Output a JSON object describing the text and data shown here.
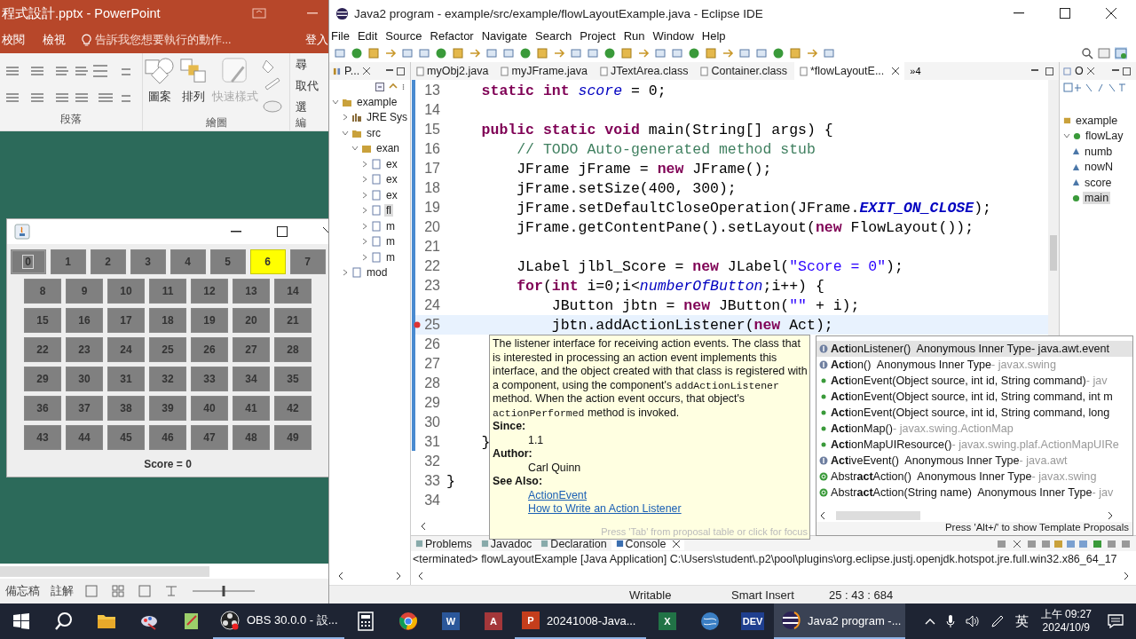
{
  "powerpoint": {
    "title": "程式設計.pptx - PowerPoint",
    "tabs": [
      "校閱",
      "檢視"
    ],
    "tell_me": "告訴我您想要執行的動作...",
    "sign_in": "登入",
    "paragraph_group": {
      "label": "段落"
    },
    "drawing_group": {
      "label": "繪圖",
      "buttons": [
        {
          "label": "圖案",
          "disabled": false
        },
        {
          "label": "排列",
          "disabled": false
        },
        {
          "label": "快速樣式",
          "disabled": true
        }
      ]
    },
    "editing_group": {
      "label": "編",
      "buttons": [
        "尋",
        "取代",
        "選"
      ]
    },
    "status_bar": {
      "notes": "備忘稿",
      "comments": "註解",
      "zoom": {
        "level": 0.5
      }
    }
  },
  "java_frame": {
    "rows": [
      {
        "buttons": [
          {
            "label": "0",
            "highlighted": false,
            "focused": true
          },
          {
            "label": "1",
            "highlighted": false,
            "focused": false
          },
          {
            "label": "2",
            "highlighted": false,
            "focused": false
          },
          {
            "label": "3",
            "highlighted": false,
            "focused": false
          },
          {
            "label": "4",
            "highlighted": false,
            "focused": false
          },
          {
            "label": "5",
            "highlighted": false,
            "focused": false
          },
          {
            "label": "6",
            "highlighted": true,
            "focused": false
          },
          {
            "label": "7",
            "highlighted": false,
            "focused": false
          }
        ]
      },
      {
        "buttons": [
          {
            "label": "8",
            "highlighted": false,
            "focused": false
          },
          {
            "label": "9",
            "highlighted": false,
            "focused": false
          },
          {
            "label": "10",
            "highlighted": false,
            "focused": false
          },
          {
            "label": "11",
            "highlighted": false,
            "focused": false
          },
          {
            "label": "12",
            "highlighted": false,
            "focused": false
          },
          {
            "label": "13",
            "highlighted": false,
            "focused": false
          },
          {
            "label": "14",
            "highlighted": false,
            "focused": false
          }
        ]
      },
      {
        "buttons": [
          {
            "label": "15",
            "highlighted": false,
            "focused": false
          },
          {
            "label": "16",
            "highlighted": false,
            "focused": false
          },
          {
            "label": "17",
            "highlighted": false,
            "focused": false
          },
          {
            "label": "18",
            "highlighted": false,
            "focused": false
          },
          {
            "label": "19",
            "highlighted": false,
            "focused": false
          },
          {
            "label": "20",
            "highlighted": false,
            "focused": false
          },
          {
            "label": "21",
            "highlighted": false,
            "focused": false
          }
        ]
      },
      {
        "buttons": [
          {
            "label": "22",
            "highlighted": false,
            "focused": false
          },
          {
            "label": "23",
            "highlighted": false,
            "focused": false
          },
          {
            "label": "24",
            "highlighted": false,
            "focused": false
          },
          {
            "label": "25",
            "highlighted": false,
            "focused": false
          },
          {
            "label": "26",
            "highlighted": false,
            "focused": false
          },
          {
            "label": "27",
            "highlighted": false,
            "focused": false
          },
          {
            "label": "28",
            "highlighted": false,
            "focused": false
          }
        ]
      },
      {
        "buttons": [
          {
            "label": "29",
            "highlighted": false,
            "focused": false
          },
          {
            "label": "30",
            "highlighted": false,
            "focused": false
          },
          {
            "label": "31",
            "highlighted": false,
            "focused": false
          },
          {
            "label": "32",
            "highlighted": false,
            "focused": false
          },
          {
            "label": "33",
            "highlighted": false,
            "focused": false
          },
          {
            "label": "34",
            "highlighted": false,
            "focused": false
          },
          {
            "label": "35",
            "highlighted": false,
            "focused": false
          }
        ]
      },
      {
        "buttons": [
          {
            "label": "36",
            "highlighted": false,
            "focused": false
          },
          {
            "label": "37",
            "highlighted": false,
            "focused": false
          },
          {
            "label": "38",
            "highlighted": false,
            "focused": false
          },
          {
            "label": "39",
            "highlighted": false,
            "focused": false
          },
          {
            "label": "40",
            "highlighted": false,
            "focused": false
          },
          {
            "label": "41",
            "highlighted": false,
            "focused": false
          },
          {
            "label": "42",
            "highlighted": false,
            "focused": false
          }
        ]
      },
      {
        "buttons": [
          {
            "label": "43",
            "highlighted": false,
            "focused": false
          },
          {
            "label": "44",
            "highlighted": false,
            "focused": false
          },
          {
            "label": "45",
            "highlighted": false,
            "focused": false
          },
          {
            "label": "46",
            "highlighted": false,
            "focused": false
          },
          {
            "label": "47",
            "highlighted": false,
            "focused": false
          },
          {
            "label": "48",
            "highlighted": false,
            "focused": false
          },
          {
            "label": "49",
            "highlighted": false,
            "focused": false
          }
        ]
      }
    ],
    "score_label": "Score = 0"
  },
  "eclipse": {
    "title": "Java2 program - example/src/example/flowLayoutExample.java - Eclipse IDE",
    "menu": [
      "File",
      "Edit",
      "Source",
      "Refactor",
      "Navigate",
      "Search",
      "Project",
      "Run",
      "Window",
      "Help"
    ],
    "explorer": {
      "tab": "P...",
      "tree": [
        {
          "label": "example",
          "kind": "project",
          "expanded": true,
          "selected": false,
          "children": [
            {
              "label": "JRE Sys",
              "kind": "library",
              "expanded": false,
              "selected": false
            },
            {
              "label": "src",
              "kind": "folder",
              "expanded": true,
              "selected": false,
              "children": [
                {
                  "label": "exan",
                  "kind": "package",
                  "expanded": true,
                  "selected": false,
                  "children": [
                    {
                      "label": "ex",
                      "kind": "file",
                      "expanded": false,
                      "selected": false
                    },
                    {
                      "label": "ex",
                      "kind": "file",
                      "expanded": false,
                      "selected": false
                    },
                    {
                      "label": "ex",
                      "kind": "file",
                      "expanded": false,
                      "selected": false
                    },
                    {
                      "label": "fl",
                      "kind": "file",
                      "expanded": false,
                      "selected": true
                    },
                    {
                      "label": "m",
                      "kind": "file",
                      "expanded": false,
                      "selected": false
                    },
                    {
                      "label": "m",
                      "kind": "file",
                      "expanded": false,
                      "selected": false
                    },
                    {
                      "label": "m",
                      "kind": "file",
                      "expanded": false,
                      "selected": false
                    }
                  ]
                }
              ]
            },
            {
              "label": "mod",
              "kind": "file",
              "expanded": false,
              "selected": false
            }
          ]
        }
      ]
    },
    "editor_tabs": [
      {
        "label": "myObj2.java",
        "selected": false
      },
      {
        "label": "myJFrame.java",
        "selected": false
      },
      {
        "label": "JTextArea.class",
        "selected": false
      },
      {
        "label": "Container.class",
        "selected": false
      },
      {
        "label": "*flowLayoutE...",
        "selected": true
      }
    ],
    "more_tabs": "»4",
    "code": [
      {
        "number": "13",
        "current": false,
        "error": false,
        "segments": [
          {
            "text": "    static int ",
            "kind": "kw"
          },
          {
            "text": "score",
            "kind": "field"
          },
          {
            "text": " = 0;",
            "kind": "plain"
          }
        ]
      },
      {
        "number": "14",
        "current": false,
        "error": false
      },
      {
        "number": "15",
        "current": false,
        "error": false,
        "segments": [
          {
            "text": "    public static void",
            "kind": "kw"
          },
          {
            "text": " main(String[] args) {",
            "kind": "plain"
          }
        ]
      },
      {
        "number": "16",
        "current": false,
        "error": false,
        "segments": [
          {
            "text": "        // TODO Auto-generated method stub",
            "kind": "comment"
          }
        ]
      },
      {
        "number": "17",
        "current": false,
        "error": false,
        "segments": [
          {
            "text": "        JFrame jFrame = ",
            "kind": "plain"
          },
          {
            "text": "new",
            "kind": "kw"
          },
          {
            "text": " JFrame();",
            "kind": "plain"
          }
        ]
      },
      {
        "number": "18",
        "current": false,
        "error": false,
        "segments": [
          {
            "text": "        jFrame.setSize(400, 300);",
            "kind": "plain"
          }
        ]
      },
      {
        "number": "19",
        "current": false,
        "error": false,
        "segments": [
          {
            "text": "        jFrame.setDefaultCloseOperation(JFrame.",
            "kind": "plain"
          },
          {
            "text": "EXIT_ON_CLOSE",
            "kind": "const"
          },
          {
            "text": ");",
            "kind": "plain"
          }
        ]
      },
      {
        "number": "20",
        "current": false,
        "error": false,
        "segments": [
          {
            "text": "        jFrame.getContentPane().setLayout(",
            "kind": "plain"
          },
          {
            "text": "new",
            "kind": "kw"
          },
          {
            "text": " FlowLayout());",
            "kind": "plain"
          }
        ]
      },
      {
        "number": "21",
        "current": false,
        "error": false
      },
      {
        "number": "22",
        "current": false,
        "error": false,
        "segments": [
          {
            "text": "        JLabel jlbl_Score = ",
            "kind": "plain"
          },
          {
            "text": "new",
            "kind": "kw"
          },
          {
            "text": " JLabel(",
            "kind": "plain"
          },
          {
            "text": "\"Score = 0\"",
            "kind": "str"
          },
          {
            "text": ");",
            "kind": "plain"
          }
        ]
      },
      {
        "number": "23",
        "current": false,
        "error": false,
        "segments": [
          {
            "text": "        for",
            "kind": "kw"
          },
          {
            "text": "(",
            "kind": "plain"
          },
          {
            "text": "int",
            "kind": "kw"
          },
          {
            "text": " i=0;i<",
            "kind": "plain"
          },
          {
            "text": "numberOfButton",
            "kind": "field"
          },
          {
            "text": ";i++) {",
            "kind": "plain"
          }
        ]
      },
      {
        "number": "24",
        "current": false,
        "error": false,
        "segments": [
          {
            "text": "            JButton jbtn = ",
            "kind": "plain"
          },
          {
            "text": "new",
            "kind": "kw"
          },
          {
            "text": " JButton(",
            "kind": "plain"
          },
          {
            "text": "\"\"",
            "kind": "str"
          },
          {
            "text": " + i);",
            "kind": "plain"
          }
        ]
      },
      {
        "number": "25",
        "current": true,
        "error": true,
        "segments": [
          {
            "text": "            jbtn.addActionListener(",
            "kind": "plain"
          },
          {
            "text": "new",
            "kind": "kw"
          },
          {
            "text": " Act);",
            "kind": "plain"
          }
        ]
      },
      {
        "number": "26",
        "current": false,
        "error": false
      },
      {
        "number": "27",
        "current": false,
        "error": false
      },
      {
        "number": "28",
        "current": false,
        "error": false
      },
      {
        "number": "29",
        "current": false,
        "error": false
      },
      {
        "number": "30",
        "current": false,
        "error": false
      },
      {
        "number": "31",
        "current": false,
        "error": false,
        "segments": [
          {
            "text": "    }",
            "kind": "plain"
          }
        ]
      },
      {
        "number": "32",
        "current": false,
        "error": false
      },
      {
        "number": "33",
        "current": false,
        "error": false,
        "segments": [
          {
            "text": "}",
            "kind": "plain"
          }
        ]
      },
      {
        "number": "34",
        "current": false,
        "error": false
      }
    ],
    "javadoc": {
      "description": [
        {
          "text": "The listener interface for receiving action events. The class that is interested in processing an action event implements this interface, and the object created with that class is registered with a component, using the component's ",
          "kind": "text"
        },
        {
          "text": "addActionListener",
          "kind": "code"
        },
        {
          "text": " method. When the action event occurs, that object's ",
          "kind": "text"
        },
        {
          "text": "actionPerformed",
          "kind": "code"
        },
        {
          "text": " method is invoked.",
          "kind": "text"
        }
      ],
      "since_label": "Since:",
      "since": "1.1",
      "author_label": "Author:",
      "author": "Carl Quinn",
      "see_also_label": "See Also:",
      "links": [
        "ActionEvent",
        "How to Write an Action Listener"
      ],
      "footer": "Press 'Tab' from proposal table or click for focus"
    },
    "proposals": {
      "items": [
        {
          "kind": "interface",
          "signature": "**Act**ionListener()",
          "detail": "Anonymous Inner Type",
          "qualifier": "- java.awt.event",
          "selected": true
        },
        {
          "kind": "interface",
          "signature": "**Act**ion()",
          "detail": "Anonymous Inner Type",
          "qualifier": "- javax.swing",
          "selected": false
        },
        {
          "kind": "constructor",
          "signature": "**Act**ionEvent(Object source, int id, String command)",
          "qualifier": "- jav",
          "selected": false
        },
        {
          "kind": "constructor",
          "signature": "**Act**ionEvent(Object source, int id, String command, int m",
          "selected": false
        },
        {
          "kind": "constructor",
          "signature": "**Act**ionEvent(Object source, int id, String command, long",
          "selected": false
        },
        {
          "kind": "constructor",
          "signature": "**Act**ionMap()",
          "qualifier": "- javax.swing.ActionMap",
          "selected": false
        },
        {
          "kind": "constructor",
          "signature": "**Act**ionMapUIResource()",
          "qualifier": "- javax.swing.plaf.ActionMapUIRe",
          "selected": false
        },
        {
          "kind": "interface",
          "signature": "**Act**iveEvent()",
          "detail": "Anonymous Inner Type",
          "qualifier": "- java.awt",
          "selected": false
        },
        {
          "kind": "class",
          "signature": "Abstr**act**Action()",
          "detail": "Anonymous Inner Type",
          "qualifier": "- javax.swing",
          "selected": false
        },
        {
          "kind": "class",
          "signature": "Abstr**act**Action(String name)",
          "detail": "Anonymous Inner Type",
          "qualifier": "- jav",
          "selected": false
        }
      ],
      "footer": "Press 'Alt+/' to show Template Proposals"
    },
    "outline": {
      "tab": "O",
      "tree": [
        {
          "label": "example",
          "kind": "package",
          "selected": false
        },
        {
          "label": "flowLay",
          "kind": "class",
          "selected": false,
          "children": [
            {
              "label": "numb",
              "kind": "field",
              "selected": false
            },
            {
              "label": "nowN",
              "kind": "field",
              "selected": false
            },
            {
              "label": "score",
              "kind": "field",
              "selected": false
            },
            {
              "label": "main",
              "kind": "method",
              "selected": true
            }
          ]
        }
      ]
    },
    "bottom_tabs": [
      {
        "label": "Problems",
        "selected": false
      },
      {
        "label": "Javadoc",
        "selected": false
      },
      {
        "label": "Declaration",
        "selected": false
      },
      {
        "label": "Console",
        "selected": true
      }
    ],
    "console": "<terminated> flowLayoutExample [Java Application] C:\\Users\\student\\.p2\\pool\\plugins\\org.eclipse.justj.openjdk.hotspot.jre.full.win32.x86_64_17",
    "status_bar": {
      "mode": "Writable",
      "insert": "Smart Insert",
      "position": "25 : 43 : 684"
    }
  },
  "taskbar": {
    "apps": [
      {
        "kind": "start",
        "running": false,
        "active": false
      },
      {
        "kind": "search",
        "running": false,
        "active": false
      },
      {
        "kind": "folder",
        "running": false,
        "active": false
      },
      {
        "kind": "paint",
        "running": false,
        "active": false
      },
      {
        "kind": "notepad",
        "running": false,
        "active": false
      },
      {
        "kind": "obs",
        "label": "OBS 30.0.0 - 設...",
        "running": true,
        "active": false
      },
      {
        "kind": "calculator",
        "running": false,
        "active": false
      },
      {
        "kind": "chrome",
        "running": false,
        "active": false
      },
      {
        "kind": "office",
        "glyph": "W",
        "color": "#2b579a",
        "running": false,
        "active": false
      },
      {
        "kind": "office",
        "glyph": "A",
        "color": "#a4373a",
        "running": false,
        "active": false
      },
      {
        "kind": "office",
        "glyph": "P",
        "color": "#c43e1c",
        "label": "20241008-Java...",
        "running": true,
        "active": false
      },
      {
        "kind": "office",
        "glyph": "X",
        "color": "#217346",
        "running": false,
        "active": false
      },
      {
        "kind": "globe",
        "running": false,
        "active": false
      },
      {
        "kind": "office",
        "glyph": "DEV",
        "color": "#1f3f8f",
        "running": false,
        "active": false
      },
      {
        "kind": "eclipse",
        "label": "Java2 program -...",
        "running": true,
        "active": true
      }
    ],
    "ime": "英",
    "time": "上午 09:27",
    "date": "2024/10/9"
  }
}
